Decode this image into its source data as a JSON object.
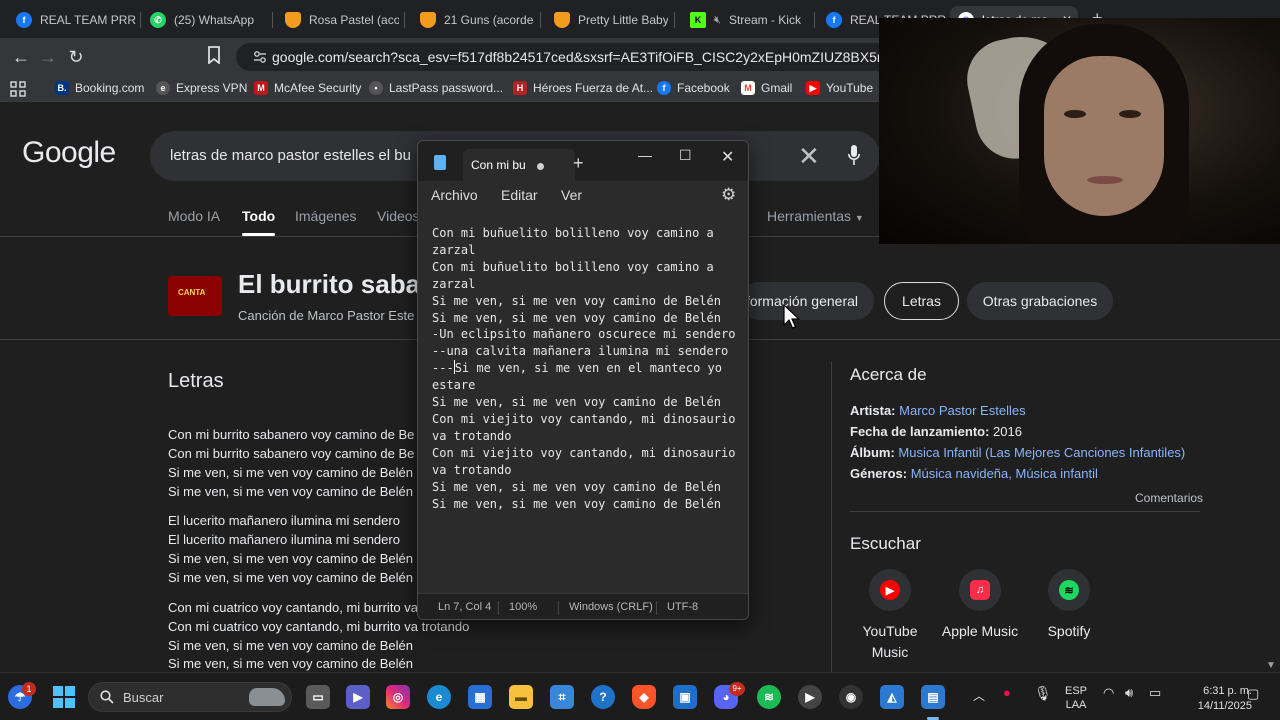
{
  "colors": {
    "accent_blue": "#8ab4f8",
    "page_bg": "#1f1f1f",
    "notepad_bg": "#2b2b2b"
  },
  "tabs": [
    {
      "label": "REAL TEAM PRRA",
      "icon": "facebook-icon"
    },
    {
      "label": "(25) WhatsApp",
      "icon": "whatsapp-icon"
    },
    {
      "label": "Rosa Pastel (acord",
      "icon": "guitar-pick-icon"
    },
    {
      "label": "21 Guns (acordes",
      "icon": "guitar-pick-icon"
    },
    {
      "label": "Pretty Little Baby",
      "icon": "guitar-pick-icon"
    },
    {
      "label": "Stream - Kick",
      "icon": "kick-icon"
    },
    {
      "label": "REAL TEAM PRRA",
      "icon": "facebook-icon"
    },
    {
      "label": "letras de ma",
      "icon": "google-icon"
    }
  ],
  "address_bar": {
    "url": "google.com/search?sca_esv=f517df8b24517ced&sxsrf=AE3TifOiFB_CISC2y2xEpH0mZIUZ8BX5mg:1763..."
  },
  "bookmarks": [
    "Booking.com",
    "Express VPN",
    "McAfee Security",
    "LastPass password...",
    "Héroes Fuerza de At...",
    "Facebook",
    "Gmail",
    "YouTube"
  ],
  "google": {
    "logo": "Google",
    "query": "letras de marco pastor estelles el bu",
    "nav_tabs": [
      "Modo IA",
      "Todo",
      "Imágenes",
      "Videos",
      "Herramientas"
    ],
    "knowledge_panel": {
      "title": "El burrito saba",
      "subtitle": "Canción de Marco Pastor Este",
      "chips": [
        "formación general",
        "Letras",
        "Otras grabaciones"
      ],
      "thumb_text": "CANTA"
    },
    "lyrics_heading": "Letras",
    "lyrics": [
      "Con mi burrito sabanero voy camino de Be",
      "Con mi burrito sabanero voy camino de Be",
      "Si me ven, si me ven voy camino de Belén",
      "Si me ven, si me ven voy camino de Belén",
      "El lucerito mañanero ilumina mi sendero",
      "El lucerito mañanero ilumina mi sendero",
      "Si me ven, si me ven voy camino de Belén",
      "Si me ven, si me ven voy camino de Belén",
      "Con mi cuatrico voy cantando, mi burrito va",
      "Con mi cuatrico voy cantando, mi burrito va trotando",
      "Si me ven, si me ven voy camino de Belén",
      "Si me ven, si me ven voy camino de Belén"
    ],
    "about": {
      "heading": "Acerca de",
      "artist_label": "Artista:",
      "artist": "Marco Pastor Estelles",
      "release_label": "Fecha de lanzamiento:",
      "release": "2016",
      "album_label": "Álbum:",
      "album": "Musica Infantil (Las Mejores Canciones Infantiles)",
      "genres_label": "Géneros:",
      "genres": "Música navideña, Música infantil",
      "comments": "Comentarios"
    },
    "listen": {
      "heading": "Escuchar",
      "services": [
        {
          "name": "YouTube Music",
          "icon": "youtube-music-icon",
          "color": "#ff0000"
        },
        {
          "name": "Apple Music",
          "icon": "apple-music-icon",
          "color": "#fa2d48"
        },
        {
          "name": "Spotify",
          "icon": "spotify-icon",
          "color": "#1ed760"
        }
      ]
    }
  },
  "notepad": {
    "tab_title": "Con mi bu",
    "menu": [
      "Archivo",
      "Editar",
      "Ver"
    ],
    "lines_before_caret": "Con mi buñuelito bolilleno voy camino a\nzarzal\nCon mi buñuelito bolilleno voy camino a\nzarzal\nSi me ven, si me ven voy camino de Belén\nSi me ven, si me ven voy camino de Belén\n-Un eclipsito mañanero oscurece mi sendero\n--una calvita mañanera ilumina mi sendero\n---",
    "lines_after_caret": "Si me ven, si me ven en el manteco yo\nestare\nSi me ven, si me ven voy camino de Belén\nCon mi viejito voy cantando, mi dinosaurio\nva trotando\nCon mi viejito voy cantando, mi dinosaurio\nva trotando\nSi me ven, si me ven voy camino de Belén\nSi me ven, si me ven voy camino de Belén",
    "status": {
      "position": "Ln 7, Col 4",
      "zoom": "100%",
      "line_ending": "Windows (CRLF)",
      "encoding": "UTF-8"
    }
  },
  "taskbar": {
    "search_placeholder": "Buscar",
    "weather_badge": "1",
    "discord_badge": "9+",
    "language": "ESP",
    "layout": "LAA",
    "time": "6:31 p. m.",
    "date": "14/11/2025"
  }
}
